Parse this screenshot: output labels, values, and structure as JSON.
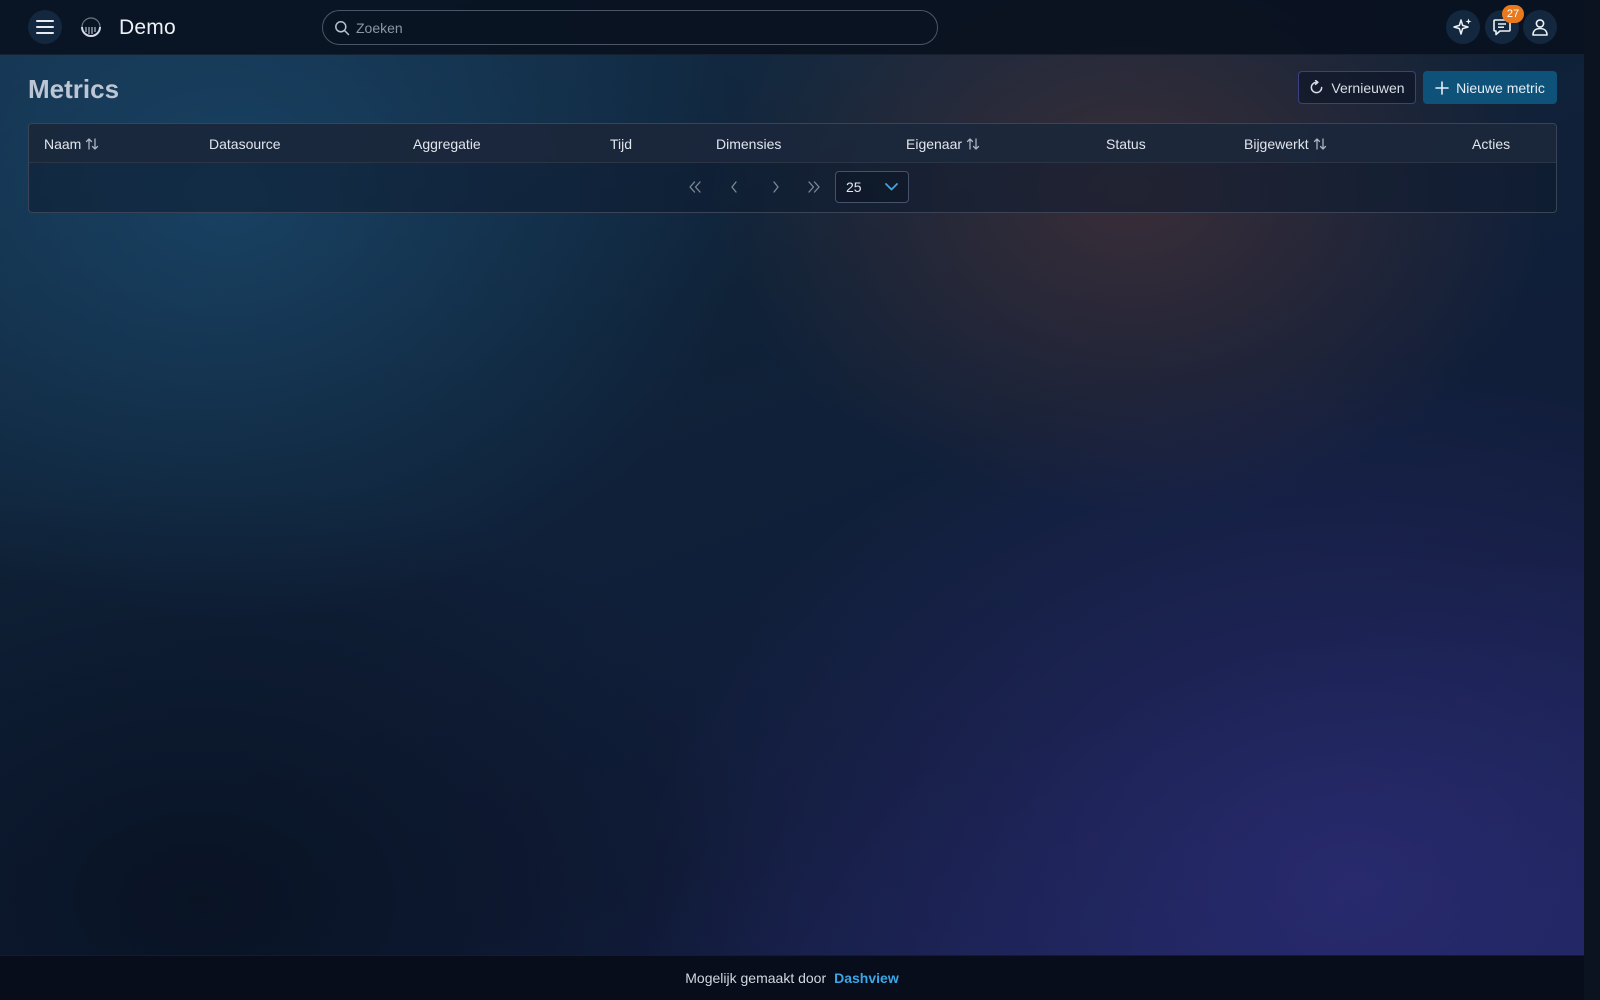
{
  "app": {
    "name": "Demo"
  },
  "search": {
    "placeholder": "Zoeken"
  },
  "notifications": {
    "count": "27"
  },
  "page": {
    "title": "Metrics",
    "refresh_label": "Vernieuwen",
    "new_label": "Nieuwe metric"
  },
  "table": {
    "columns": [
      {
        "label": "Naam",
        "sortable": true
      },
      {
        "label": "Datasource",
        "sortable": false
      },
      {
        "label": "Aggregatie",
        "sortable": false
      },
      {
        "label": "Tijd",
        "sortable": false
      },
      {
        "label": "Dimensies",
        "sortable": false
      },
      {
        "label": "Eigenaar",
        "sortable": true
      },
      {
        "label": "Status",
        "sortable": false
      },
      {
        "label": "Bijgewerkt",
        "sortable": true
      },
      {
        "label": "Acties",
        "sortable": false
      }
    ],
    "rows": []
  },
  "pagination": {
    "page_size": "25"
  },
  "footer": {
    "text": "Mogelijk gemaakt door",
    "link": "Dashview"
  },
  "colors": {
    "accent": "#3aa7e6",
    "primary_button": "#0e527a",
    "badge": "#e8791e"
  },
  "icons": {
    "menu": "hamburger-menu-icon",
    "search": "search-icon",
    "ai": "sparkles-icon",
    "chat": "chat-icon",
    "user": "user-icon",
    "refresh": "refresh-icon",
    "add": "plus-icon",
    "sort": "sort-arrows-icon"
  }
}
